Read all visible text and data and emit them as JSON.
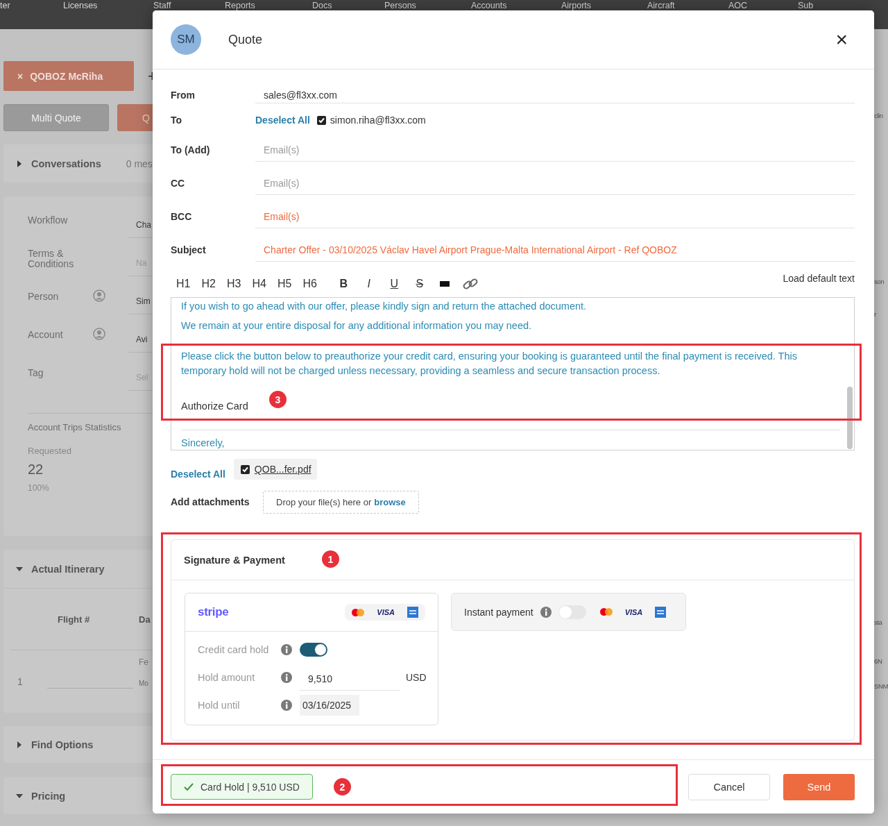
{
  "background": {
    "nav": [
      "ter",
      "Licenses",
      "Staff",
      "Reports",
      "Docs",
      "Persons",
      "Accounts",
      "Airports",
      "Aircraft",
      "AOC",
      "Sub"
    ],
    "tab": {
      "close": "×",
      "label": "QOBOZ McRiha"
    },
    "add_tab": "+",
    "buttons": [
      {
        "label": "Multi Quote",
        "kind": "secondary"
      },
      {
        "label": "Q",
        "kind": "primary"
      }
    ],
    "conversations": {
      "title": "Conversations",
      "expanded": false,
      "count": "0 mes"
    },
    "fields": [
      {
        "label": "Workflow",
        "value": "Cha",
        "kind": "text"
      },
      {
        "label": "Terms & Conditions",
        "placeholder": "Na",
        "kind": "text"
      },
      {
        "label": "Person",
        "value": "Sim",
        "kind": "person"
      },
      {
        "label": "Account",
        "value": "Avi",
        "kind": "person"
      },
      {
        "label": "Tag",
        "placeholder": "Sel",
        "kind": "text"
      }
    ],
    "stats": {
      "title": "Account Trips Statistics",
      "label": "Requested",
      "value": "22",
      "percent": "100%"
    },
    "itinerary": {
      "title": "Actual Itinerary",
      "expanded": true,
      "columns": [
        "Flight #",
        "Da"
      ],
      "row": {
        "number": "1",
        "cell_top": "Fe",
        "cell_bottom": "Mo"
      }
    },
    "sections": [
      {
        "title": "Find Options",
        "expanded": false
      },
      {
        "title": "Pricing",
        "expanded": true
      }
    ],
    "right_edge": [
      "clin",
      "son",
      "r",
      "sta",
      "6N",
      "SNM"
    ]
  },
  "dialog": {
    "avatar": "SM",
    "title": "Quote",
    "close": "×",
    "from": {
      "label": "From",
      "value": "sales@fl3xx.com"
    },
    "to": {
      "label": "To",
      "deselect": "Deselect All",
      "recipients": [
        {
          "email": "simon.riha@fl3xx.com",
          "checked": true
        }
      ]
    },
    "fields": [
      {
        "label": "To (Add)",
        "placeholder": "Email(s)",
        "error": false
      },
      {
        "label": "CC",
        "placeholder": "Email(s)",
        "error": false
      },
      {
        "label": "BCC",
        "placeholder": "Email(s)",
        "error": true
      },
      {
        "label": "Subject",
        "value": "Charter Offer - 03/10/2025 Václav Havel Airport Prague-Malta International Airport - Ref QOBOZ",
        "error": true
      }
    ],
    "toolbar": [
      {
        "label": "H1",
        "kind": "text"
      },
      {
        "label": "H2",
        "kind": "text"
      },
      {
        "label": "H3",
        "kind": "text"
      },
      {
        "label": "H4",
        "kind": "text"
      },
      {
        "label": "H5",
        "kind": "text"
      },
      {
        "label": "H6",
        "kind": "text"
      },
      {
        "label": "B",
        "kind": "bold"
      },
      {
        "label": "I",
        "kind": "italic"
      },
      {
        "label": "U",
        "kind": "underline"
      },
      {
        "label": "S",
        "kind": "strike"
      },
      {
        "kind": "block"
      },
      {
        "kind": "link"
      }
    ],
    "load_default": "Load default text",
    "body": [
      {
        "kind": "paragraph",
        "text": "If you wish to go ahead with our offer, please kindly sign and return the attached document."
      },
      {
        "kind": "paragraph",
        "text": "We remain at your entire disposal for any additional information you may need."
      },
      {
        "kind": "paragraph",
        "text": "Please click the button below to preauthorize your credit card, ensuring your booking is guaranteed until the final payment is received. This temporary hold will not be charged unless necessary, providing a seamless and secure transaction process."
      },
      {
        "kind": "button_text",
        "text": "Authorize Card"
      },
      {
        "kind": "rule"
      },
      {
        "kind": "paragraph",
        "text": "Sincerely,"
      }
    ],
    "attachments": {
      "deselect": "Deselect All",
      "files": [
        {
          "name": "QOB...fer.pdf",
          "checked": true
        }
      ],
      "add_label": "Add attachments",
      "drop_text": "Drop your file(s) here or",
      "browse": "browse"
    },
    "payment": {
      "title": "Signature & Payment",
      "stripe": {
        "logo": "stripe",
        "brands": [
          {
            "kind": "mastercard"
          },
          {
            "kind": "visa",
            "label": "VISA"
          },
          {
            "kind": "amex"
          }
        ],
        "rows": [
          {
            "label": "Credit card hold",
            "kind": "toggle",
            "on": true
          },
          {
            "label": "Hold amount",
            "kind": "amount",
            "value": "9,510",
            "unit": "USD"
          },
          {
            "label": "Hold until",
            "kind": "date",
            "value": "03/16/2025"
          }
        ]
      },
      "instant": {
        "label": "Instant payment",
        "on": false,
        "brands": [
          {
            "kind": "mastercard"
          },
          {
            "kind": "visa",
            "label": "VISA"
          },
          {
            "kind": "amex"
          }
        ]
      }
    },
    "footer": {
      "hold_status": "Card Hold | 9,510 USD",
      "buttons": [
        {
          "label": "Cancel",
          "kind": "secondary"
        },
        {
          "label": "Send",
          "kind": "primary"
        }
      ]
    }
  },
  "annotations": [
    {
      "label": "3"
    },
    {
      "label": "1"
    },
    {
      "label": "2"
    }
  ]
}
